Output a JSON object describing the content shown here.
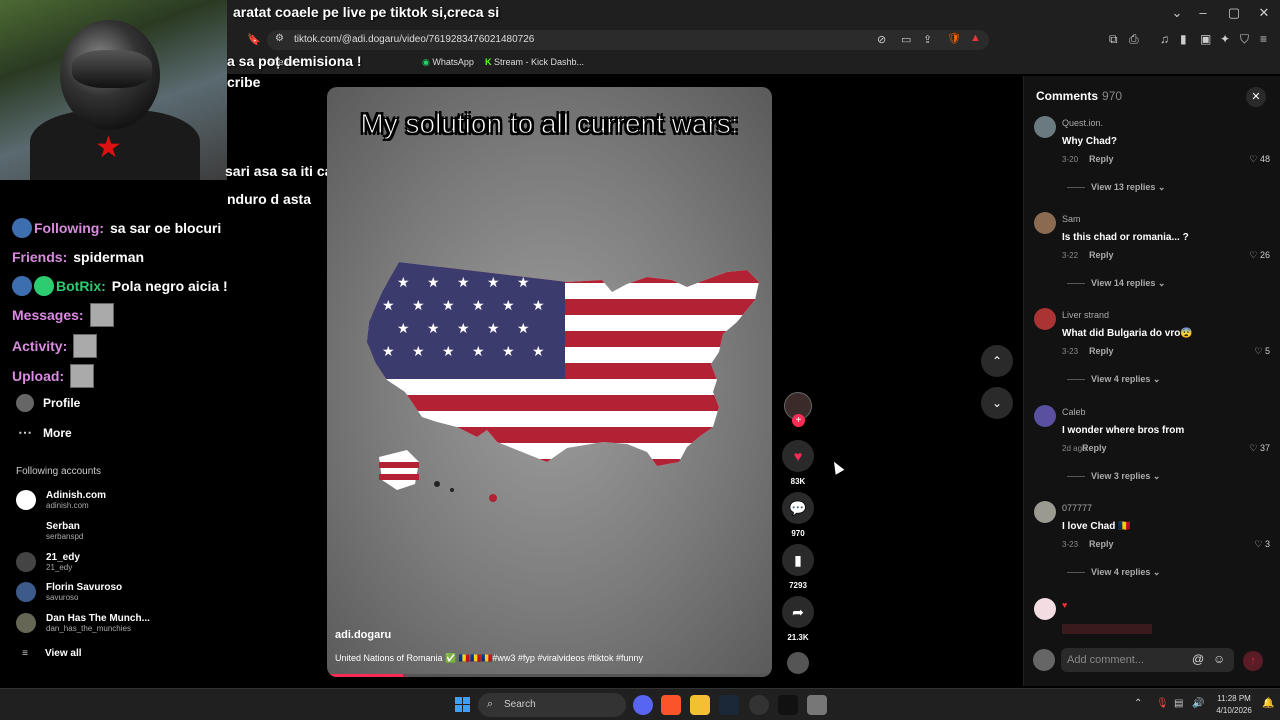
{
  "browser": {
    "tab_title": "aratat coaele pe live pe tiktok si,creca si",
    "url": "tiktok.com/@adi.dogaru/video/7619283476021480726",
    "bookmarks": [
      {
        "label": "Stream -...",
        "icon": "stream-icon"
      },
      {
        "label": "WhatsApp",
        "icon": "whatsapp-icon"
      },
      {
        "label": "Stream - Kick Dashb...",
        "icon": "kick-icon"
      }
    ]
  },
  "overlay": {
    "line1": "a sa poț demisiona !",
    "line2": "cribe",
    "line3": "sari asa sa iti cada motoru pe cap",
    "line4": "nduro d asta"
  },
  "chat": [
    {
      "name": "Following:",
      "message": "sa sar oe blocuri",
      "emote": false
    },
    {
      "name": "Friends:",
      "message": "spiderman",
      "emote": false
    },
    {
      "name": "BotRix:",
      "message": "Pola negro aicia !",
      "emote": false
    },
    {
      "name": "Messages:",
      "message": "",
      "emote": true
    },
    {
      "name": "Activity:",
      "message": "",
      "emote": true
    },
    {
      "name": "Upload:",
      "message": "",
      "emote": true
    }
  ],
  "sidebar": {
    "profile_label": "Profile",
    "more_label": "More",
    "following_title": "Following accounts",
    "accounts": [
      {
        "name": "Adinish.com",
        "handle": "adinish.com"
      },
      {
        "name": "Serban",
        "handle": "serbanspd"
      },
      {
        "name": "21_edy",
        "handle": "21_edy"
      },
      {
        "name": "Florin Savuroso",
        "handle": "savuroso"
      },
      {
        "name": "Dan Has The Munch...",
        "handle": "dan_has_the_munchies"
      }
    ],
    "view_all": "View all"
  },
  "video": {
    "caption": "My solution to all current wars:",
    "author": "adi.dogaru",
    "description": "United Nations of Romania ✅ 🇷🇴🇷🇴🇷🇴#ww3 #fyp #viralvideos #tiktok #funny",
    "progress": 0.17
  },
  "actions": {
    "likes": "83K",
    "comments": "970",
    "saves": "7293",
    "shares": "21.3K"
  },
  "comments_panel": {
    "title": "Comments",
    "count": "970",
    "reply_label": "Reply",
    "items": [
      {
        "user": "Quest.ion.",
        "text": "Why Chad?",
        "date": "3-20",
        "likes": "48",
        "replies": "View 13 replies"
      },
      {
        "user": "Sam",
        "text": "Is this chad or romania... ?",
        "date": "3-22",
        "likes": "26",
        "replies": "View 14 replies"
      },
      {
        "user": "Liver strand",
        "text": "What did Bulgaria do vro😨",
        "date": "3-23",
        "likes": "5",
        "replies": "View 4 replies"
      },
      {
        "user": "Caleb",
        "text": "I wonder where bros from",
        "date": "2d ago",
        "likes": "37",
        "replies": "View 3 replies"
      },
      {
        "user": "077777",
        "text": "I love Chad 🇹🇩",
        "date": "3-23",
        "likes": "3",
        "replies": "View 4 replies"
      }
    ],
    "add_placeholder": "Add comment..."
  },
  "taskbar": {
    "search_label": "Search",
    "time": "11:28 PM",
    "date": "4/10/2026"
  },
  "colors": {
    "accent": "#fe2c55",
    "panel": "#121212"
  }
}
